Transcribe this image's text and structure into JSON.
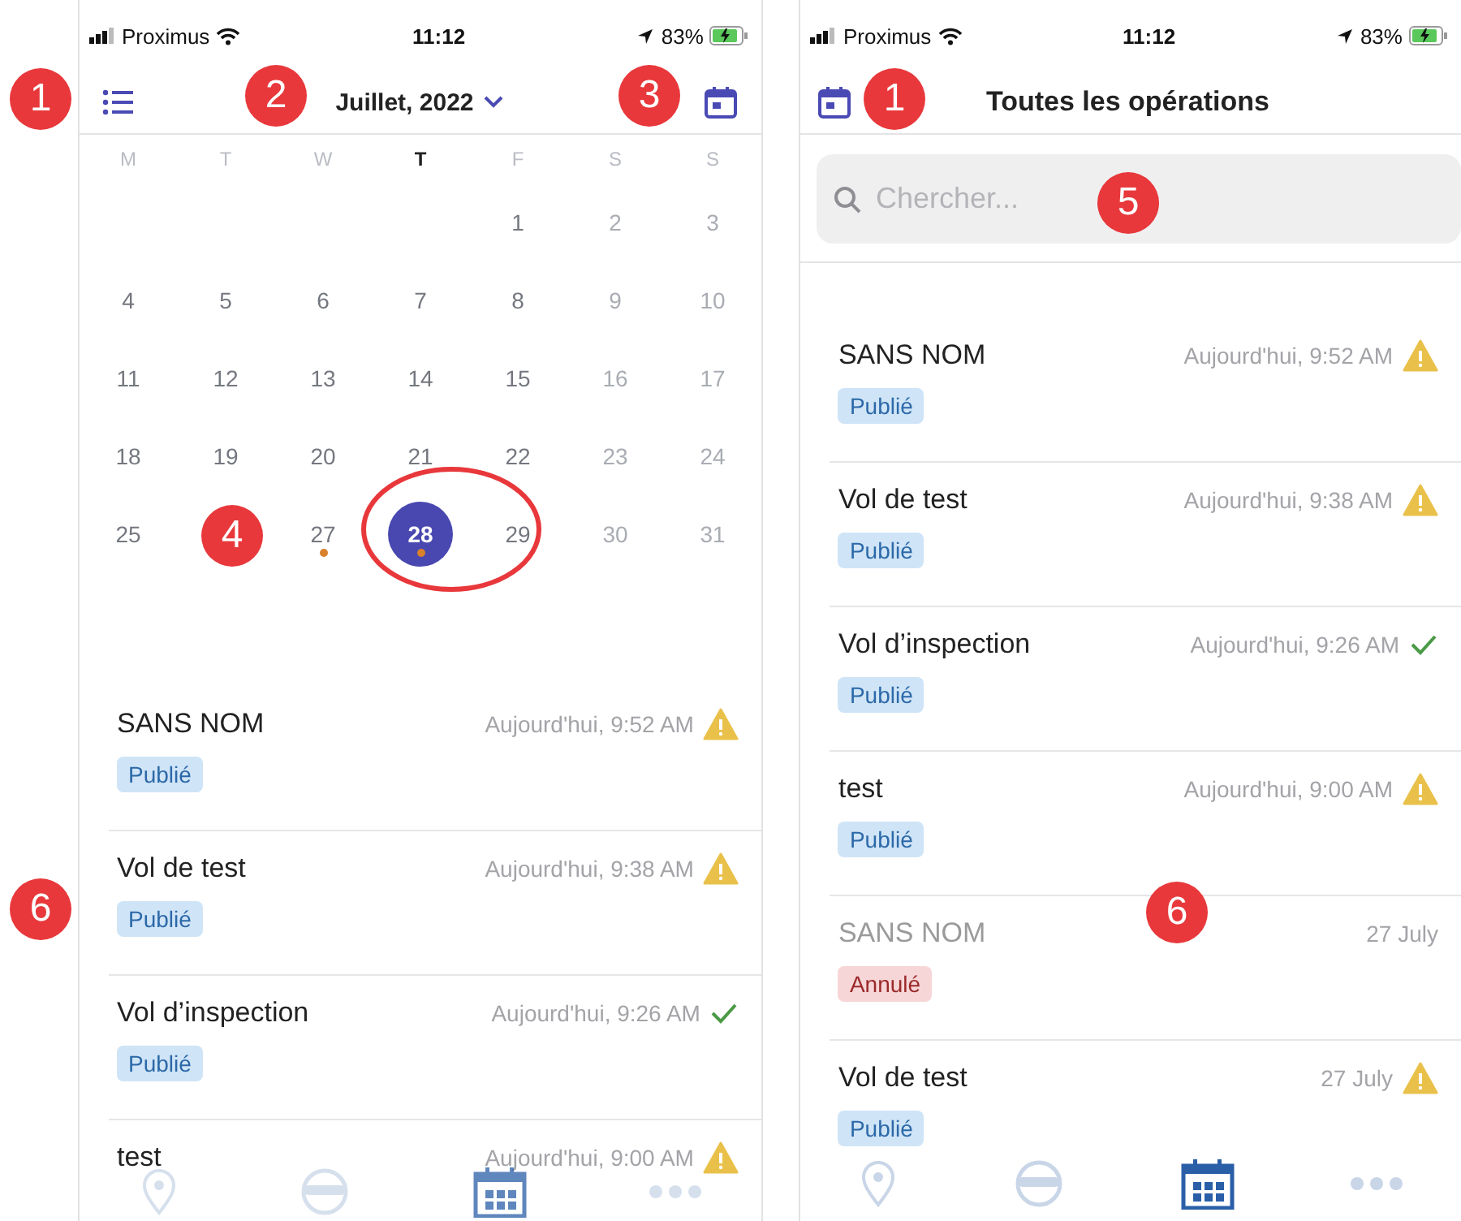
{
  "phones": [
    {
      "kind": "calendar",
      "status_bar": {
        "carrier": "Proximus",
        "time": "11:12",
        "battery": "83%"
      },
      "header": {
        "title": "Juillet, 2022"
      },
      "calendar": {
        "weekdays": [
          {
            "label": "M",
            "today": false
          },
          {
            "label": "T",
            "today": false
          },
          {
            "label": "W",
            "today": false
          },
          {
            "label": "T",
            "today": true
          },
          {
            "label": "F",
            "today": false
          },
          {
            "label": "S",
            "today": false
          },
          {
            "label": "S",
            "today": false
          }
        ],
        "weeks": [
          [
            {
              "kind": "empty"
            },
            {
              "kind": "empty"
            },
            {
              "kind": "empty"
            },
            {
              "kind": "empty"
            },
            {
              "kind": "day",
              "label": "1",
              "muted": false,
              "selected": false,
              "has_event": false
            },
            {
              "kind": "day",
              "label": "2",
              "muted": true,
              "selected": false,
              "has_event": false
            },
            {
              "kind": "day",
              "label": "3",
              "muted": true,
              "selected": false,
              "has_event": false
            }
          ],
          [
            {
              "kind": "day",
              "label": "4",
              "muted": false,
              "selected": false,
              "has_event": false
            },
            {
              "kind": "day",
              "label": "5",
              "muted": false,
              "selected": false,
              "has_event": false
            },
            {
              "kind": "day",
              "label": "6",
              "muted": false,
              "selected": false,
              "has_event": false
            },
            {
              "kind": "day",
              "label": "7",
              "muted": false,
              "selected": false,
              "has_event": false
            },
            {
              "kind": "day",
              "label": "8",
              "muted": false,
              "selected": false,
              "has_event": false
            },
            {
              "kind": "day",
              "label": "9",
              "muted": true,
              "selected": false,
              "has_event": false
            },
            {
              "kind": "day",
              "label": "10",
              "muted": true,
              "selected": false,
              "has_event": false
            }
          ],
          [
            {
              "kind": "day",
              "label": "11",
              "muted": false,
              "selected": false,
              "has_event": false
            },
            {
              "kind": "day",
              "label": "12",
              "muted": false,
              "selected": false,
              "has_event": false
            },
            {
              "kind": "day",
              "label": "13",
              "muted": false,
              "selected": false,
              "has_event": false
            },
            {
              "kind": "day",
              "label": "14",
              "muted": false,
              "selected": false,
              "has_event": false
            },
            {
              "kind": "day",
              "label": "15",
              "muted": false,
              "selected": false,
              "has_event": false
            },
            {
              "kind": "day",
              "label": "16",
              "muted": true,
              "selected": false,
              "has_event": false
            },
            {
              "kind": "day",
              "label": "17",
              "muted": true,
              "selected": false,
              "has_event": false
            }
          ],
          [
            {
              "kind": "day",
              "label": "18",
              "muted": false,
              "selected": false,
              "has_event": false
            },
            {
              "kind": "day",
              "label": "19",
              "muted": false,
              "selected": false,
              "has_event": false
            },
            {
              "kind": "day",
              "label": "20",
              "muted": false,
              "selected": false,
              "has_event": false
            },
            {
              "kind": "day",
              "label": "21",
              "muted": false,
              "selected": false,
              "has_event": false
            },
            {
              "kind": "day",
              "label": "22",
              "muted": false,
              "selected": false,
              "has_event": false
            },
            {
              "kind": "day",
              "label": "23",
              "muted": true,
              "selected": false,
              "has_event": false
            },
            {
              "kind": "day",
              "label": "24",
              "muted": true,
              "selected": false,
              "has_event": false
            }
          ],
          [
            {
              "kind": "day",
              "label": "25",
              "muted": false,
              "selected": false,
              "has_event": false
            },
            {
              "kind": "empty"
            },
            {
              "kind": "day",
              "label": "27",
              "muted": false,
              "selected": false,
              "has_event": true
            },
            {
              "kind": "day",
              "label": "28",
              "muted": false,
              "selected": true,
              "has_event": true
            },
            {
              "kind": "day",
              "label": "29",
              "muted": false,
              "selected": false,
              "has_event": false
            },
            {
              "kind": "day",
              "label": "30",
              "muted": true,
              "selected": false,
              "has_event": false
            },
            {
              "kind": "day",
              "label": "31",
              "muted": true,
              "selected": false,
              "has_event": false
            }
          ]
        ]
      },
      "operations": [
        {
          "name": "SANS NOM",
          "time": "Aujourd'hui, 9:52 AM",
          "alert": true,
          "done": false,
          "dimmed": false,
          "badge": {
            "label": "Publié",
            "kind": "published"
          }
        },
        {
          "name": "Vol de test",
          "time": "Aujourd'hui, 9:38 AM",
          "alert": true,
          "done": false,
          "dimmed": false,
          "badge": {
            "label": "Publié",
            "kind": "published"
          }
        },
        {
          "name": "Vol d’inspection",
          "time": "Aujourd'hui, 9:26 AM",
          "alert": false,
          "done": true,
          "dimmed": false,
          "badge": {
            "label": "Publié",
            "kind": "published"
          }
        },
        {
          "name": "test",
          "time": "Aujourd'hui, 9:00 AM",
          "alert": true,
          "done": false,
          "dimmed": false
        }
      ],
      "tab_bar": [
        {
          "kind": "pin",
          "selected": false
        },
        {
          "kind": "face",
          "selected": false
        },
        {
          "kind": "calendar",
          "selected": true
        },
        {
          "kind": "more",
          "selected": false
        }
      ]
    },
    {
      "kind": "list",
      "status_bar": {
        "carrier": "Proximus",
        "time": "11:12",
        "battery": "83%"
      },
      "header": {
        "title": "Toutes les opérations"
      },
      "search": {
        "placeholder": "Chercher..."
      },
      "operations": [
        {
          "name": "SANS NOM",
          "time": "Aujourd'hui, 9:52 AM",
          "alert": true,
          "done": false,
          "dimmed": false,
          "badge": {
            "label": "Publié",
            "kind": "published"
          }
        },
        {
          "name": "Vol de test",
          "time": "Aujourd'hui, 9:38 AM",
          "alert": true,
          "done": false,
          "dimmed": false,
          "badge": {
            "label": "Publié",
            "kind": "published"
          }
        },
        {
          "name": "Vol d’inspection",
          "time": "Aujourd'hui, 9:26 AM",
          "alert": false,
          "done": true,
          "dimmed": false,
          "badge": {
            "label": "Publié",
            "kind": "published"
          }
        },
        {
          "name": "test",
          "time": "Aujourd'hui, 9:00 AM",
          "alert": true,
          "done": false,
          "dimmed": false,
          "badge": {
            "label": "Publié",
            "kind": "published"
          }
        },
        {
          "name": "SANS NOM",
          "time": "27 July",
          "alert": false,
          "done": false,
          "dimmed": true,
          "badge": {
            "label": "Annulé",
            "kind": "cancelled"
          }
        },
        {
          "name": "Vol de test",
          "time": "27 July",
          "alert": true,
          "done": false,
          "dimmed": false,
          "badge": {
            "label": "Publié",
            "kind": "published"
          }
        }
      ],
      "tab_bar": [
        {
          "kind": "pin",
          "selected": false
        },
        {
          "kind": "face",
          "selected": false
        },
        {
          "kind": "calendar",
          "selected": true
        },
        {
          "kind": "more",
          "selected": false
        }
      ]
    }
  ],
  "callouts": [
    {
      "label": "1"
    },
    {
      "label": "2"
    },
    {
      "label": "3"
    },
    {
      "label": "4"
    },
    {
      "label": "6"
    },
    {
      "label": "1"
    },
    {
      "label": "5"
    },
    {
      "label": "6"
    }
  ]
}
